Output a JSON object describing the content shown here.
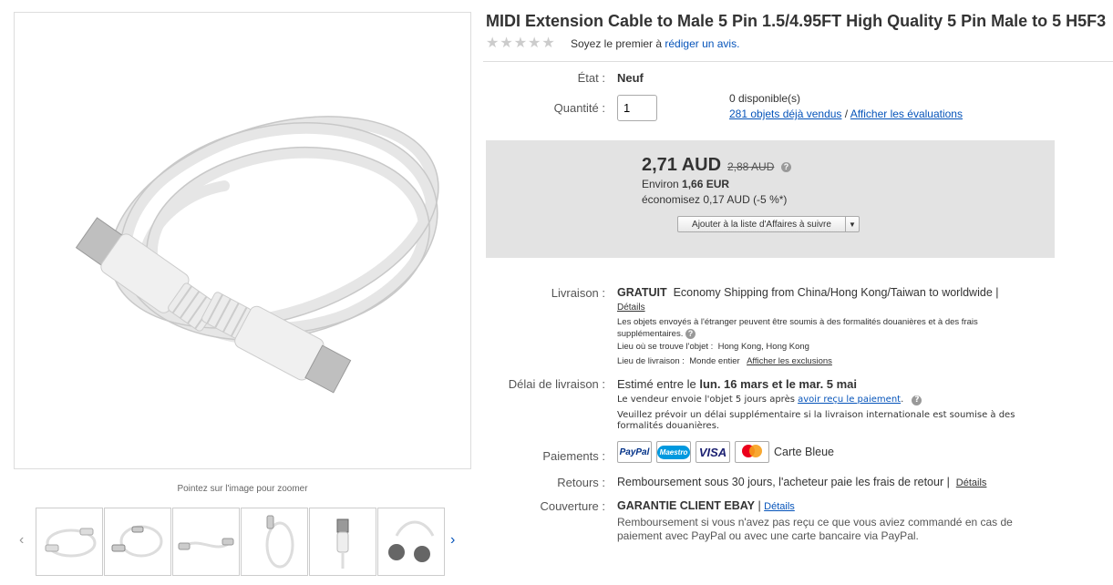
{
  "product": {
    "title": "MIDI Extension Cable to Male 5 Pin 1.5/4.95FT High Quality 5 Pin Male to 5 H5F3",
    "rating_stars": 0,
    "review_prompt": "Soyez le premier à",
    "review_link": "rédiger un avis."
  },
  "gallery": {
    "zoom_hint": "Pointez sur l'image pour zoomer",
    "thumbnail_count": 6
  },
  "details": {
    "state_label": "État :",
    "state_value": "Neuf",
    "qty_label": "Quantité :",
    "qty_value": "1",
    "available": "0 disponible(s)",
    "sold_link": "281 objets déjà vendus",
    "sep": "/",
    "reviews_link": "Afficher les évaluations"
  },
  "price": {
    "current": "2,71 AUD",
    "old": "2,88 AUD",
    "approx_prefix": "Environ",
    "approx_value": "1,66 EUR",
    "savings": "économisez 0,17 AUD (-5 %*)",
    "watch_button": "Ajouter à la liste d'Affaires à suivre"
  },
  "shipping": {
    "label": "Livraison :",
    "free": "GRATUIT",
    "method": "Economy Shipping from China/Hong Kong/Taiwan to worldwide |",
    "details_link": "Détails",
    "customs_note": "Les objets envoyés à l'étranger peuvent être soumis à des formalités douanières et à des frais supplémentaires.",
    "location_label": "Lieu où se trouve l'objet :",
    "location_value": "Hong Kong, Hong Kong",
    "ships_to_label": "Lieu de livraison :",
    "ships_to_value": "Monde entier",
    "exclusions_link": "Afficher les exclusions"
  },
  "delivery": {
    "label": "Délai de livraison :",
    "prefix": "Estimé entre le",
    "dates": "lun. 16 mars et le mar. 5 mai",
    "seller_note": "Le vendeur envoie l'objet 5 jours après",
    "payment_link": "avoir reçu le paiement",
    "period": ".",
    "intl_note": "Veuillez prévoir un délai supplémentaire si la livraison internationale est soumise à des formalités douanières."
  },
  "payments": {
    "label": "Paiements :",
    "methods": [
      "PayPal",
      "Maestro",
      "VISA",
      "Mastercard"
    ],
    "extra": "Carte Bleue"
  },
  "returns": {
    "label": "Retours :",
    "text": "Remboursement sous 30 jours, l'acheteur paie les frais de retour |",
    "details_link": "Détails"
  },
  "coverage": {
    "label": "Couverture :",
    "title": "GARANTIE CLIENT EBAY",
    "sep": "|",
    "details_link": "Détails",
    "text": "Remboursement si vous n'avez pas reçu ce que vous aviez commandé en cas de paiement avec PayPal ou avec une carte bancaire via PayPal."
  },
  "colors": {
    "link": "#0654ba",
    "price_box": "#e3e3e3",
    "paypal_blue": "#003087",
    "maestro_blue": "#0099df",
    "visa_blue": "#1a1f71",
    "mc_red": "#eb001b",
    "mc_orange": "#f79e1b"
  }
}
